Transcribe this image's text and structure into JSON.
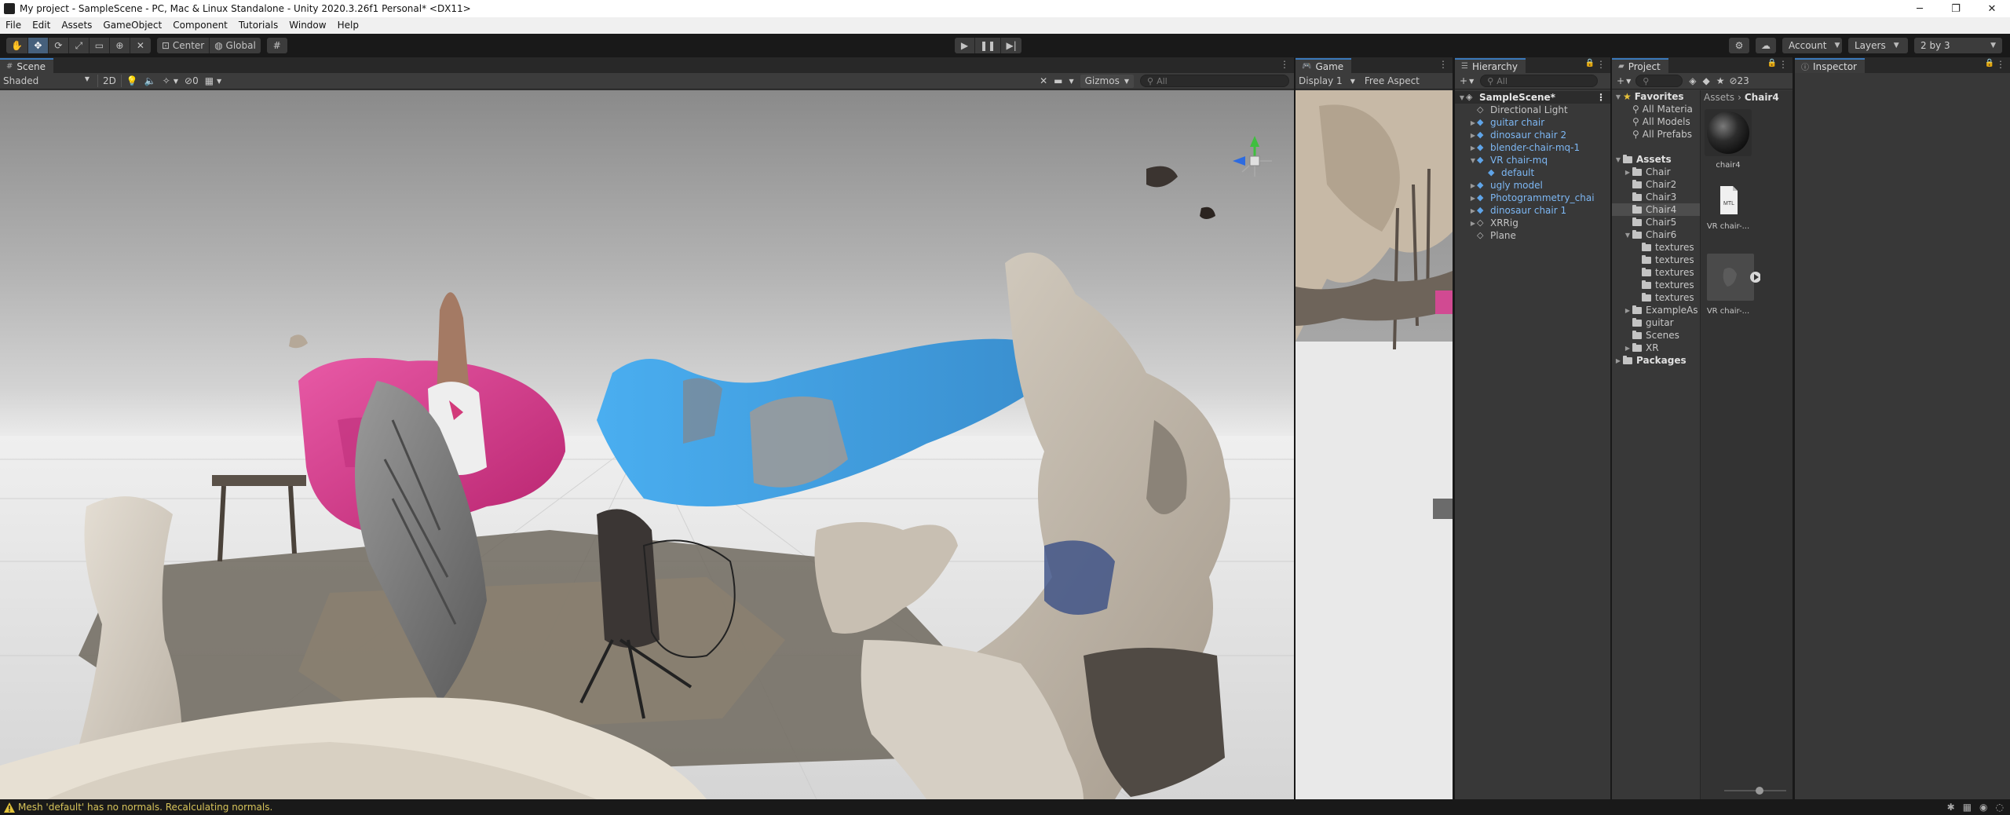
{
  "window": {
    "title": "My project - SampleScene - PC, Mac & Linux Standalone - Unity 2020.3.26f1 Personal* <DX11>",
    "minimize": "─",
    "maximize": "❐",
    "close": "✕"
  },
  "menu": [
    "File",
    "Edit",
    "Assets",
    "GameObject",
    "Component",
    "Tutorials",
    "Window",
    "Help"
  ],
  "toolbar": {
    "pivot": "Center",
    "space": "Global",
    "account": "Account",
    "layers": "Layers",
    "layout": "2 by 3"
  },
  "scene": {
    "tab": "Scene",
    "shading": "Shaded",
    "mode_2d": "2D",
    "hidden_count": "0",
    "gizmos": "Gizmos",
    "search_placeholder": "All"
  },
  "game": {
    "tab": "Game",
    "display": "Display 1",
    "aspect": "Free Aspect"
  },
  "hierarchy": {
    "tab": "Hierarchy",
    "search_placeholder": "All",
    "items": [
      {
        "label": "SampleScene*",
        "indent": 0,
        "arrow": "▼",
        "type": "scene"
      },
      {
        "label": "Directional Light",
        "indent": 1,
        "arrow": "",
        "type": "object"
      },
      {
        "label": "guitar chair",
        "indent": 1,
        "arrow": "▶",
        "type": "prefab"
      },
      {
        "label": "dinosaur chair 2",
        "indent": 1,
        "arrow": "▶",
        "type": "prefab"
      },
      {
        "label": "blender-chair-mq-1",
        "indent": 1,
        "arrow": "▶",
        "type": "prefab"
      },
      {
        "label": "VR chair-mq",
        "indent": 1,
        "arrow": "▼",
        "type": "prefab"
      },
      {
        "label": "default",
        "indent": 2,
        "arrow": "",
        "type": "prefab"
      },
      {
        "label": "ugly model",
        "indent": 1,
        "arrow": "▶",
        "type": "prefab"
      },
      {
        "label": "Photogrammetry_chai",
        "indent": 1,
        "arrow": "▶",
        "type": "prefab"
      },
      {
        "label": "dinosaur chair 1",
        "indent": 1,
        "arrow": "▶",
        "type": "prefab"
      },
      {
        "label": "XRRig",
        "indent": 1,
        "arrow": "▶",
        "type": "object"
      },
      {
        "label": "Plane",
        "indent": 1,
        "arrow": "",
        "type": "object"
      }
    ]
  },
  "project": {
    "tab": "Project",
    "hidden_count": "23",
    "breadcrumb_root": "Assets",
    "breadcrumb_current": "Chair4",
    "tree": [
      {
        "label": "Favorites",
        "indent": 0,
        "arrow": "▼",
        "kind": "favorites"
      },
      {
        "label": "All Materia",
        "indent": 1,
        "arrow": "",
        "kind": "search"
      },
      {
        "label": "All Models",
        "indent": 1,
        "arrow": "",
        "kind": "search"
      },
      {
        "label": "All Prefabs",
        "indent": 1,
        "arrow": "",
        "kind": "search"
      },
      {
        "label": "",
        "indent": 0,
        "arrow": "",
        "kind": "spacer"
      },
      {
        "label": "Assets",
        "indent": 0,
        "arrow": "▼",
        "kind": "header"
      },
      {
        "label": "Chair",
        "indent": 1,
        "arrow": "▶",
        "kind": "folder"
      },
      {
        "label": "Chair2",
        "indent": 1,
        "arrow": "",
        "kind": "folder"
      },
      {
        "label": "Chair3",
        "indent": 1,
        "arrow": "",
        "kind": "folder"
      },
      {
        "label": "Chair4",
        "indent": 1,
        "arrow": "",
        "kind": "folder",
        "selected": true
      },
      {
        "label": "Chair5",
        "indent": 1,
        "arrow": "",
        "kind": "folder"
      },
      {
        "label": "Chair6",
        "indent": 1,
        "arrow": "▼",
        "kind": "folder"
      },
      {
        "label": "textures",
        "indent": 2,
        "arrow": "",
        "kind": "folder"
      },
      {
        "label": "textures",
        "indent": 2,
        "arrow": "",
        "kind": "folder"
      },
      {
        "label": "textures",
        "indent": 2,
        "arrow": "",
        "kind": "folder"
      },
      {
        "label": "textures",
        "indent": 2,
        "arrow": "",
        "kind": "folder"
      },
      {
        "label": "textures",
        "indent": 2,
        "arrow": "",
        "kind": "folder"
      },
      {
        "label": "ExampleAs",
        "indent": 1,
        "arrow": "▶",
        "kind": "folder"
      },
      {
        "label": "guitar",
        "indent": 1,
        "arrow": "",
        "kind": "folder"
      },
      {
        "label": "Scenes",
        "indent": 1,
        "arrow": "",
        "kind": "folder"
      },
      {
        "label": "XR",
        "indent": 1,
        "arrow": "▶",
        "kind": "folder"
      },
      {
        "label": "Packages",
        "indent": 0,
        "arrow": "▶",
        "kind": "header"
      }
    ],
    "assets": [
      {
        "label": "chair4",
        "kind": "material"
      },
      {
        "label": "VR chair-...",
        "kind": "mtl"
      },
      {
        "label": "VR chair-...",
        "kind": "model"
      }
    ]
  },
  "inspector": {
    "tab": "Inspector"
  },
  "status": {
    "message": "Mesh 'default' has no normals. Recalculating normals."
  },
  "colors": {
    "accent_blue": "#3a79bb",
    "prefab_blue": "#7db7f3",
    "warning_yellow": "#d6c35a"
  }
}
